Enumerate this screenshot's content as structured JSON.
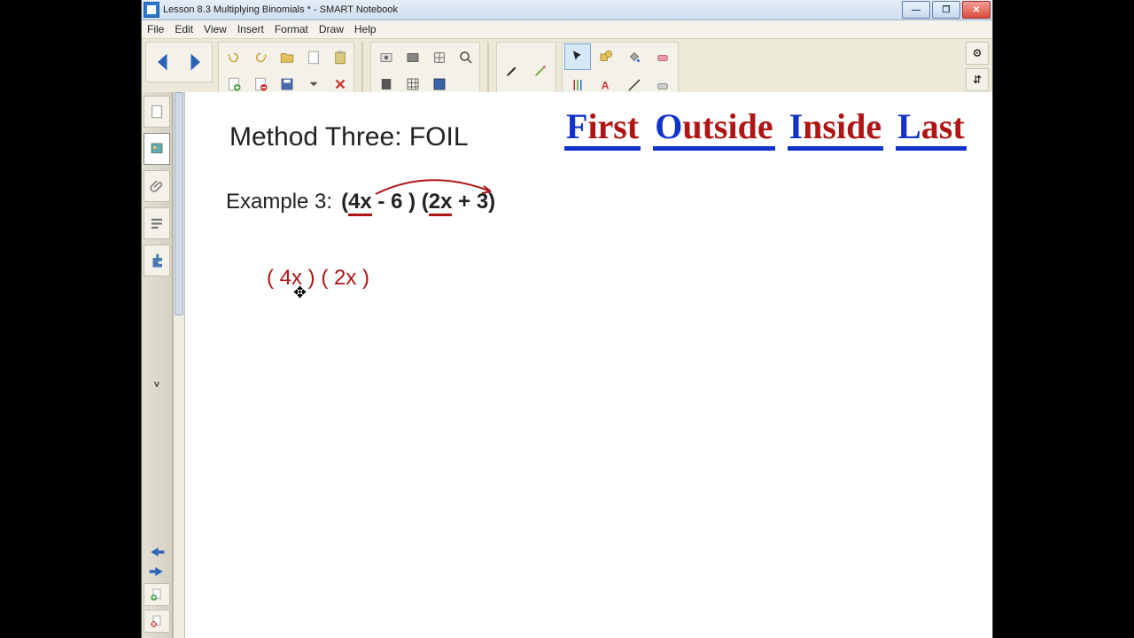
{
  "window": {
    "title": "Lesson 8.3 Multiplying Binomials * - SMART Notebook"
  },
  "menu": {
    "file": "File",
    "edit": "Edit",
    "view": "View",
    "insert": "Insert",
    "format": "Format",
    "draw": "Draw",
    "help": "Help"
  },
  "wincontrols": {
    "min": "—",
    "max": "❐",
    "close": "✕"
  },
  "content": {
    "heading": "Method Three: FOIL",
    "foil": {
      "f_cap": "F",
      "f_rest": "irst",
      "o_cap": "O",
      "o_rest": "utside",
      "i_cap": "I",
      "i_rest": "nside",
      "l_cap": "L",
      "l_rest": "ast"
    },
    "example_label": "Example 3:",
    "expr_open1": "(",
    "expr_t1": "4x",
    "expr_mid1": " - 6 ) (",
    "expr_t2": "2x",
    "expr_close": " + 3)",
    "work": "( 4x ) ( 2x )"
  },
  "icons": {
    "back": "←",
    "forward": "→",
    "gear": "⚙",
    "updown": "⇵",
    "collapse": "˅",
    "plus": "+",
    "x": "×"
  }
}
